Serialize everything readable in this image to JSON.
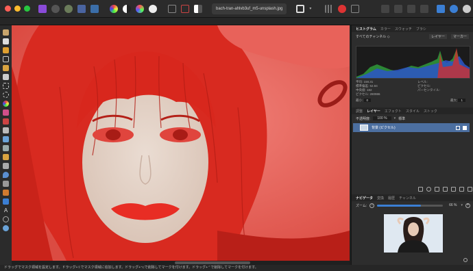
{
  "window": {
    "document_name": "bach-tran-ahlvb3uf_m5-unsplash.jpg"
  },
  "toolbar": {
    "persona_icons": [
      "affinity-photo-icon",
      "develop-persona-icon",
      "liquify-persona-icon",
      "export-persona-icon",
      "tone-map-persona-icon"
    ],
    "adjust_icons": [
      "auto-levels-icon",
      "auto-contrast-icon",
      "auto-colors-icon",
      "auto-white-balance-icon"
    ],
    "right_icons": [
      "snapping-icon",
      "assistant-icon",
      "studio-icon",
      "arrange-icon"
    ]
  },
  "panels": {
    "top": {
      "tabs": [
        "ヒストグラム",
        "カラー",
        "スウォッチ",
        "ブラシ"
      ],
      "active_tab": "ヒストグラム",
      "channel_select": "すべてのチャンネル",
      "view_buttons": [
        "レイヤー",
        "マーカー"
      ],
      "stats_left": [
        "平均: 158.31",
        "標準偏差: 62.84",
        "中央値: 182",
        "ピクセル: 280986"
      ],
      "stats_right": [
        "レベル:",
        "ピクセル:",
        "パーセンタイル:"
      ],
      "min_label": "最小:",
      "min_value": "0",
      "max_label": "最大:",
      "max_value": "1"
    },
    "middle": {
      "tabs": [
        "調整",
        "レイヤー",
        "エフェクト",
        "スタイル",
        "ストック"
      ],
      "active_tab": "レイヤー",
      "opacity_label": "不透明度:",
      "opacity_value": "100 %",
      "blend_mode": "標準",
      "layer_name": "背景 (ピクセル)"
    },
    "bottom": {
      "tabs": [
        "ナビゲータ",
        "変換",
        "履歴",
        "チャンネル"
      ],
      "active_tab": "ナビゲータ",
      "zoom_label": "ズーム:",
      "zoom_value": "66 %",
      "zoom_fraction": 0.66
    }
  },
  "status_bar": {
    "text": "ドラッグでマスク領域を設定します。ドラッグ+⇧でマスク領域に追加します。ドラッグ+⌥で削除してマークを付けます。ドラッグ+⌃で削除してマークを付けます。"
  },
  "colors": {
    "mask_red": "#e0453d",
    "selected_layer": "#4c6fa0",
    "panel_bg": "#2d2d2d"
  }
}
